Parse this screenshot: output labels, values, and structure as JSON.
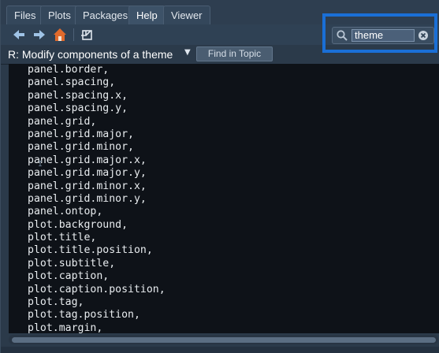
{
  "tabs": [
    {
      "label": "Files"
    },
    {
      "label": "Plots"
    },
    {
      "label": "Packages"
    },
    {
      "label": "Help"
    },
    {
      "label": "Viewer"
    }
  ],
  "active_tab": "Help",
  "toolbar": {
    "back_icon": "arrow-left-icon",
    "forward_icon": "arrow-right-icon",
    "home_icon": "home-icon",
    "popout_icon": "popout-icon",
    "search_icon": "search-icon",
    "clear_icon": "clear-icon",
    "search_value": "theme"
  },
  "topic": {
    "title": "R: Modify components of a theme",
    "find_label": "Find in Topic"
  },
  "content": {
    "lines": [
      "panel.border,",
      "panel.spacing,",
      "panel.spacing.x,",
      "panel.spacing.y,",
      "panel.grid,",
      "panel.grid.major,",
      "panel.grid.minor,",
      "panel.grid.major.x,",
      "panel.grid.major.y,",
      "panel.grid.minor.x,",
      "panel.grid.minor.y,",
      "panel.ontop,",
      "plot.background,",
      "plot.title,",
      "plot.title.position,",
      "plot.subtitle,",
      "plot.caption,",
      "plot.caption.position,",
      "plot.tag,",
      "plot.tag.position,",
      "plot.margin,"
    ]
  },
  "colors": {
    "accent_highlight": "#1a6fd6",
    "home_icon": "#e06a2c",
    "arrow_icon": "#9fc3e6"
  }
}
